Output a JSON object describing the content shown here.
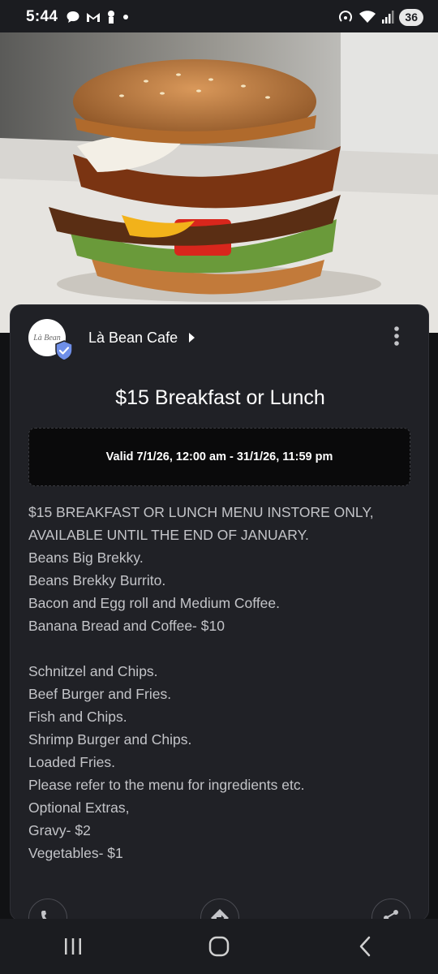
{
  "status_bar": {
    "time": "5:44",
    "battery": "36",
    "left_icons": [
      "chat-icon",
      "gmail-icon",
      "lock-icon",
      "dot-icon"
    ],
    "right_icons": [
      "hotspot-icon",
      "wifi-icon",
      "signal-icon"
    ]
  },
  "hero": {
    "image": "burger-photo"
  },
  "merchant": {
    "logo_text": "Là Bean",
    "name": "Là Bean Cafe"
  },
  "offer": {
    "title": "$15 Breakfast or Lunch",
    "validity": "Valid 7/1/26, 12:00 am - 31/1/26, 11:59 pm",
    "description_lines": [
      "$15 BREAKFAST OR LUNCH MENU INSTORE ONLY,",
      "AVAILABLE UNTIL THE END OF JANUARY.",
      "Beans Big Brekky.",
      "Beans Brekky Burrito.",
      "Bacon and Egg roll and Medium Coffee.",
      "Banana Bread and Coffee- $10",
      "",
      "Schnitzel and Chips.",
      "Beef Burger and Fries.",
      "Fish and Chips.",
      "Shrimp Burger and Chips.",
      "Loaded Fries.",
      "Please refer to the menu for ingredients etc.",
      "Optional Extras,",
      "Gravy- $2",
      "Vegetables- $1"
    ]
  },
  "actions": [
    "phone-icon",
    "directions-icon",
    "share-icon"
  ],
  "nav": [
    "recent-apps-icon",
    "home-icon",
    "back-icon"
  ],
  "colors": {
    "background": "#111214",
    "card": "#202126",
    "text_primary": "#ffffff",
    "text_secondary": "#c3c4c8",
    "badge": "#6f8fe8"
  }
}
